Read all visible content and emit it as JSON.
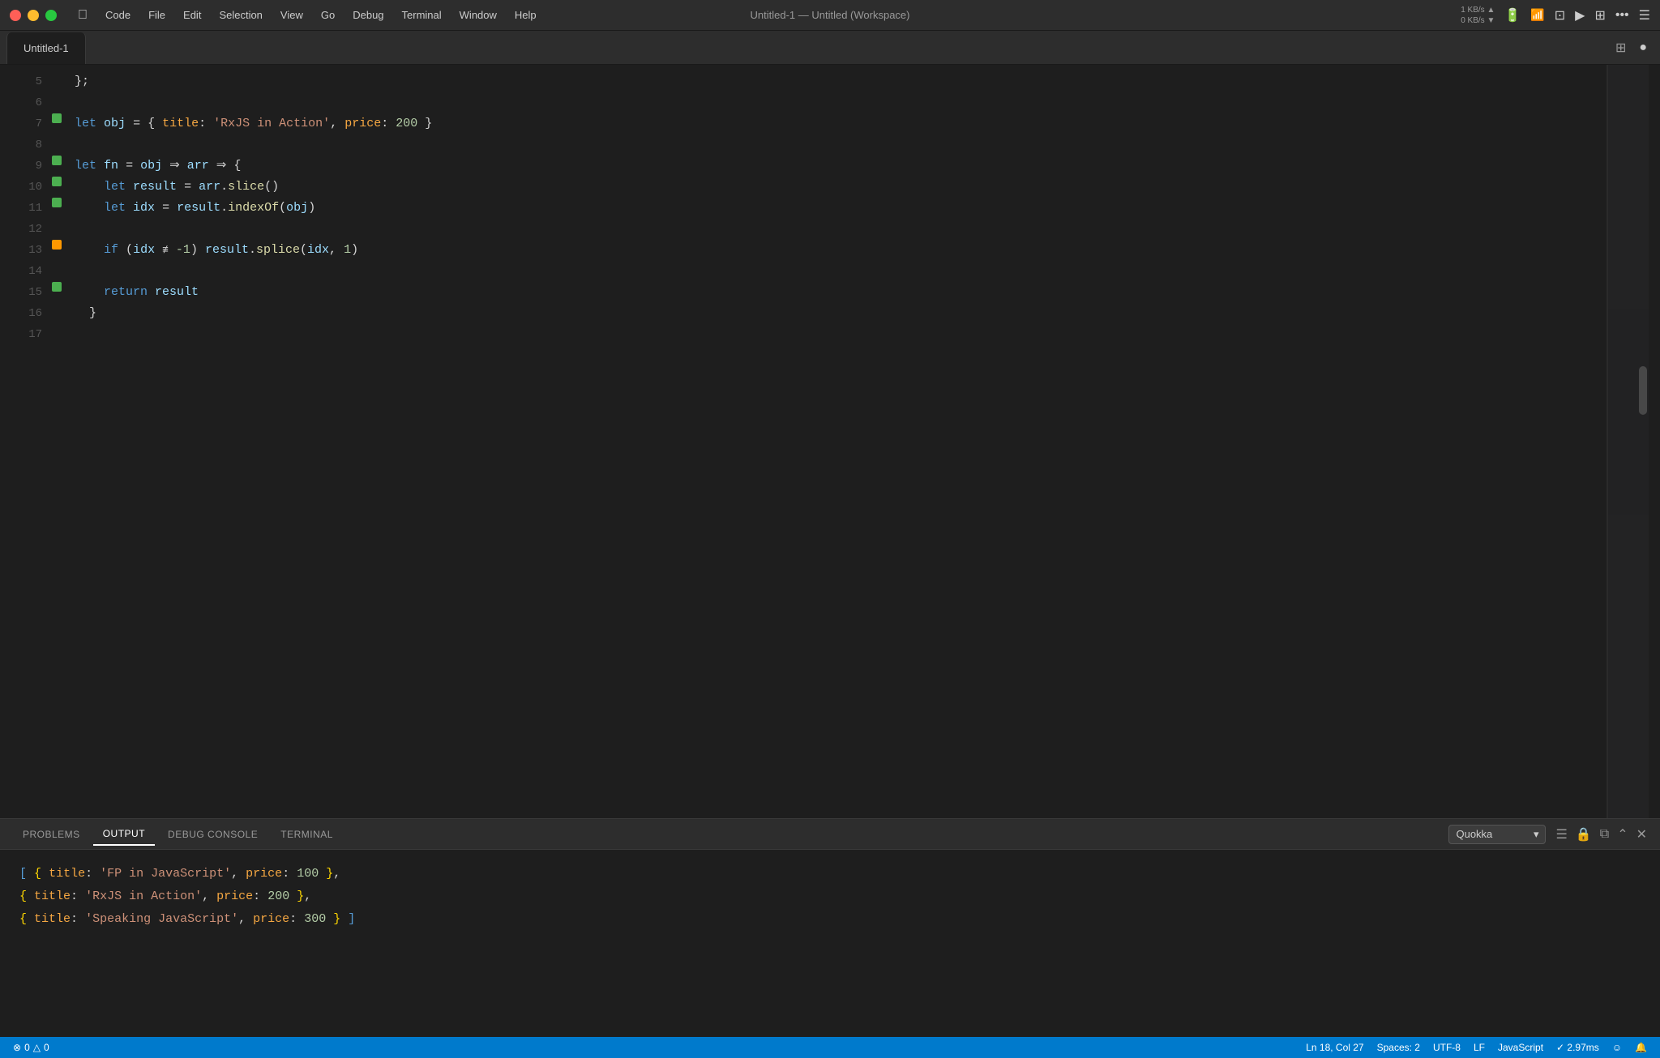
{
  "menubar": {
    "apple_label": "",
    "items": [
      "Code",
      "File",
      "Edit",
      "Selection",
      "View",
      "Go",
      "Debug",
      "Terminal",
      "Window",
      "Help"
    ],
    "title": "Untitled-1 — Untitled (Workspace)",
    "network_stats": "1 KB/s\n0 KB/s"
  },
  "tab": {
    "label": "Untitled-1",
    "dot_label": "●"
  },
  "editor": {
    "lines": [
      {
        "num": "5",
        "indicator": null,
        "content_html": "  <span class='punc'>};</span>"
      },
      {
        "num": "6",
        "indicator": null,
        "content_html": ""
      },
      {
        "num": "7",
        "indicator": "green",
        "content_html": "<span class='kw'>let</span> <span class='var'>obj</span> <span class='op'>=</span> <span class='punc'>{ </span><span class='obj-key'>title</span><span class='punc'>:</span> <span class='str'>'RxJS in Action'</span><span class='punc'>,</span> <span class='obj-key'>price</span><span class='punc'>:</span> <span class='num'>200</span> <span class='punc'>}</span>"
      },
      {
        "num": "8",
        "indicator": null,
        "content_html": ""
      },
      {
        "num": "9",
        "indicator": "green",
        "content_html": "<span class='kw'>let</span> <span class='var'>fn</span> <span class='op'>=</span> <span class='var'>obj</span> <span class='arrow'>⇒</span> <span class='var'>arr</span> <span class='arrow'>⇒</span> <span class='punc'>{</span>"
      },
      {
        "num": "10",
        "indicator": "green",
        "content_html": "    <span class='kw'>let</span> <span class='var'>result</span> <span class='op'>=</span> <span class='var'>arr</span><span class='punc'>.</span><span class='method'>slice</span><span class='punc'>()</span>"
      },
      {
        "num": "11",
        "indicator": "green",
        "content_html": "    <span class='kw'>let</span> <span class='var'>idx</span> <span class='op'>=</span> <span class='var'>result</span><span class='punc'>.</span><span class='method'>indexOf</span><span class='punc'>(</span><span class='var'>obj</span><span class='punc'>)</span>"
      },
      {
        "num": "12",
        "indicator": null,
        "content_html": ""
      },
      {
        "num": "13",
        "indicator": "orange",
        "content_html": "    <span class='kw'>if</span> <span class='punc'>(</span><span class='var'>idx</span> <span class='op'>≢</span> <span class='num'>-1</span><span class='punc'>)</span> <span class='var'>result</span><span class='punc'>.</span><span class='method'>splice</span><span class='punc'>(</span><span class='var'>idx</span><span class='punc'>,</span> <span class='num'>1</span><span class='punc'>)</span>"
      },
      {
        "num": "14",
        "indicator": null,
        "content_html": ""
      },
      {
        "num": "15",
        "indicator": "green",
        "content_html": "    <span class='kw'>return</span> <span class='var'>result</span>"
      },
      {
        "num": "16",
        "indicator": null,
        "content_html": "  <span class='punc'>}</span>"
      },
      {
        "num": "17",
        "indicator": null,
        "content_html": ""
      }
    ]
  },
  "panel": {
    "tabs": [
      "PROBLEMS",
      "OUTPUT",
      "DEBUG CONSOLE",
      "TERMINAL"
    ],
    "active_tab": "OUTPUT",
    "dropdown_value": "Quokka",
    "output_lines": [
      "[ { title: 'FP in JavaScript', price: 100 },",
      "  { title: 'RxJS in Action', price: 200 },",
      "  { title: 'Speaking JavaScript', price: 300 } ]"
    ]
  },
  "status_bar": {
    "errors": "0",
    "warnings": "0",
    "line": "Ln 18, Col 27",
    "spaces": "Spaces: 2",
    "encoding": "UTF-8",
    "line_ending": "LF",
    "language": "JavaScript",
    "timing": "✓ 2.97ms",
    "error_icon": "⊗",
    "warning_icon": "△",
    "feedback_icon": "☺",
    "bell_icon": "🔔"
  }
}
